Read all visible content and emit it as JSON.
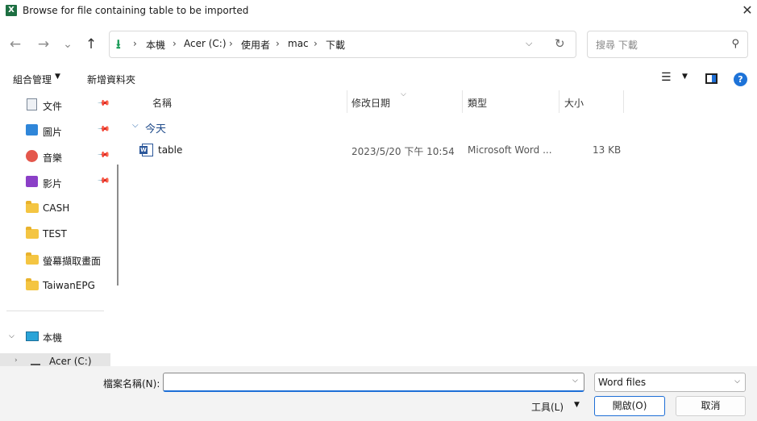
{
  "window": {
    "title": "Browse for file containing table to be imported",
    "app_icon": "X",
    "close": "✕"
  },
  "nav": {
    "back": "←",
    "forward": "→",
    "recent": "⌄",
    "up": "↑"
  },
  "address": {
    "icon": "download-arrow",
    "breadcrumbs": [
      "本機",
      "Acer (C:)",
      "使用者",
      "mac",
      "下載"
    ],
    "separator": "›"
  },
  "search": {
    "placeholder": "搜尋 下載"
  },
  "toolbar": {
    "organize": "組合管理",
    "new_folder": "新增資料夾",
    "help": "?"
  },
  "sidebar": {
    "quick_access": [
      {
        "label": "文件",
        "icon": "documents-icon",
        "pinned": true
      },
      {
        "label": "圖片",
        "icon": "pictures-icon",
        "pinned": true
      },
      {
        "label": "音樂",
        "icon": "music-icon",
        "pinned": true
      },
      {
        "label": "影片",
        "icon": "videos-icon",
        "pinned": true
      },
      {
        "label": "CASH",
        "icon": "folder-icon",
        "pinned": false
      },
      {
        "label": "TEST",
        "icon": "folder-icon",
        "pinned": false
      },
      {
        "label": "螢幕擷取畫面",
        "icon": "folder-icon",
        "pinned": false
      },
      {
        "label": "TaiwanEPG",
        "icon": "folder-icon",
        "pinned": false
      }
    ],
    "this_pc": "本機",
    "drive": "Acer (C:)"
  },
  "filelist": {
    "columns": [
      "名稱",
      "修改日期",
      "類型",
      "大小"
    ],
    "group": "今天",
    "files": [
      {
        "name": "table",
        "modified": "2023/5/20 下午 10:54",
        "type": "Microsoft Word ...",
        "size": "13 KB"
      }
    ]
  },
  "footer": {
    "filename_label": "檔案名稱(N):",
    "filename_value": "",
    "filetype": "Word files",
    "tools": "工具(L)",
    "open": "開啟(O)",
    "cancel": "取消"
  },
  "colors": {
    "accent": "#1e6fd6",
    "excel": "#1d6f42",
    "word": "#2b579a",
    "folder": "#f4c542",
    "download": "#1a9c58"
  }
}
